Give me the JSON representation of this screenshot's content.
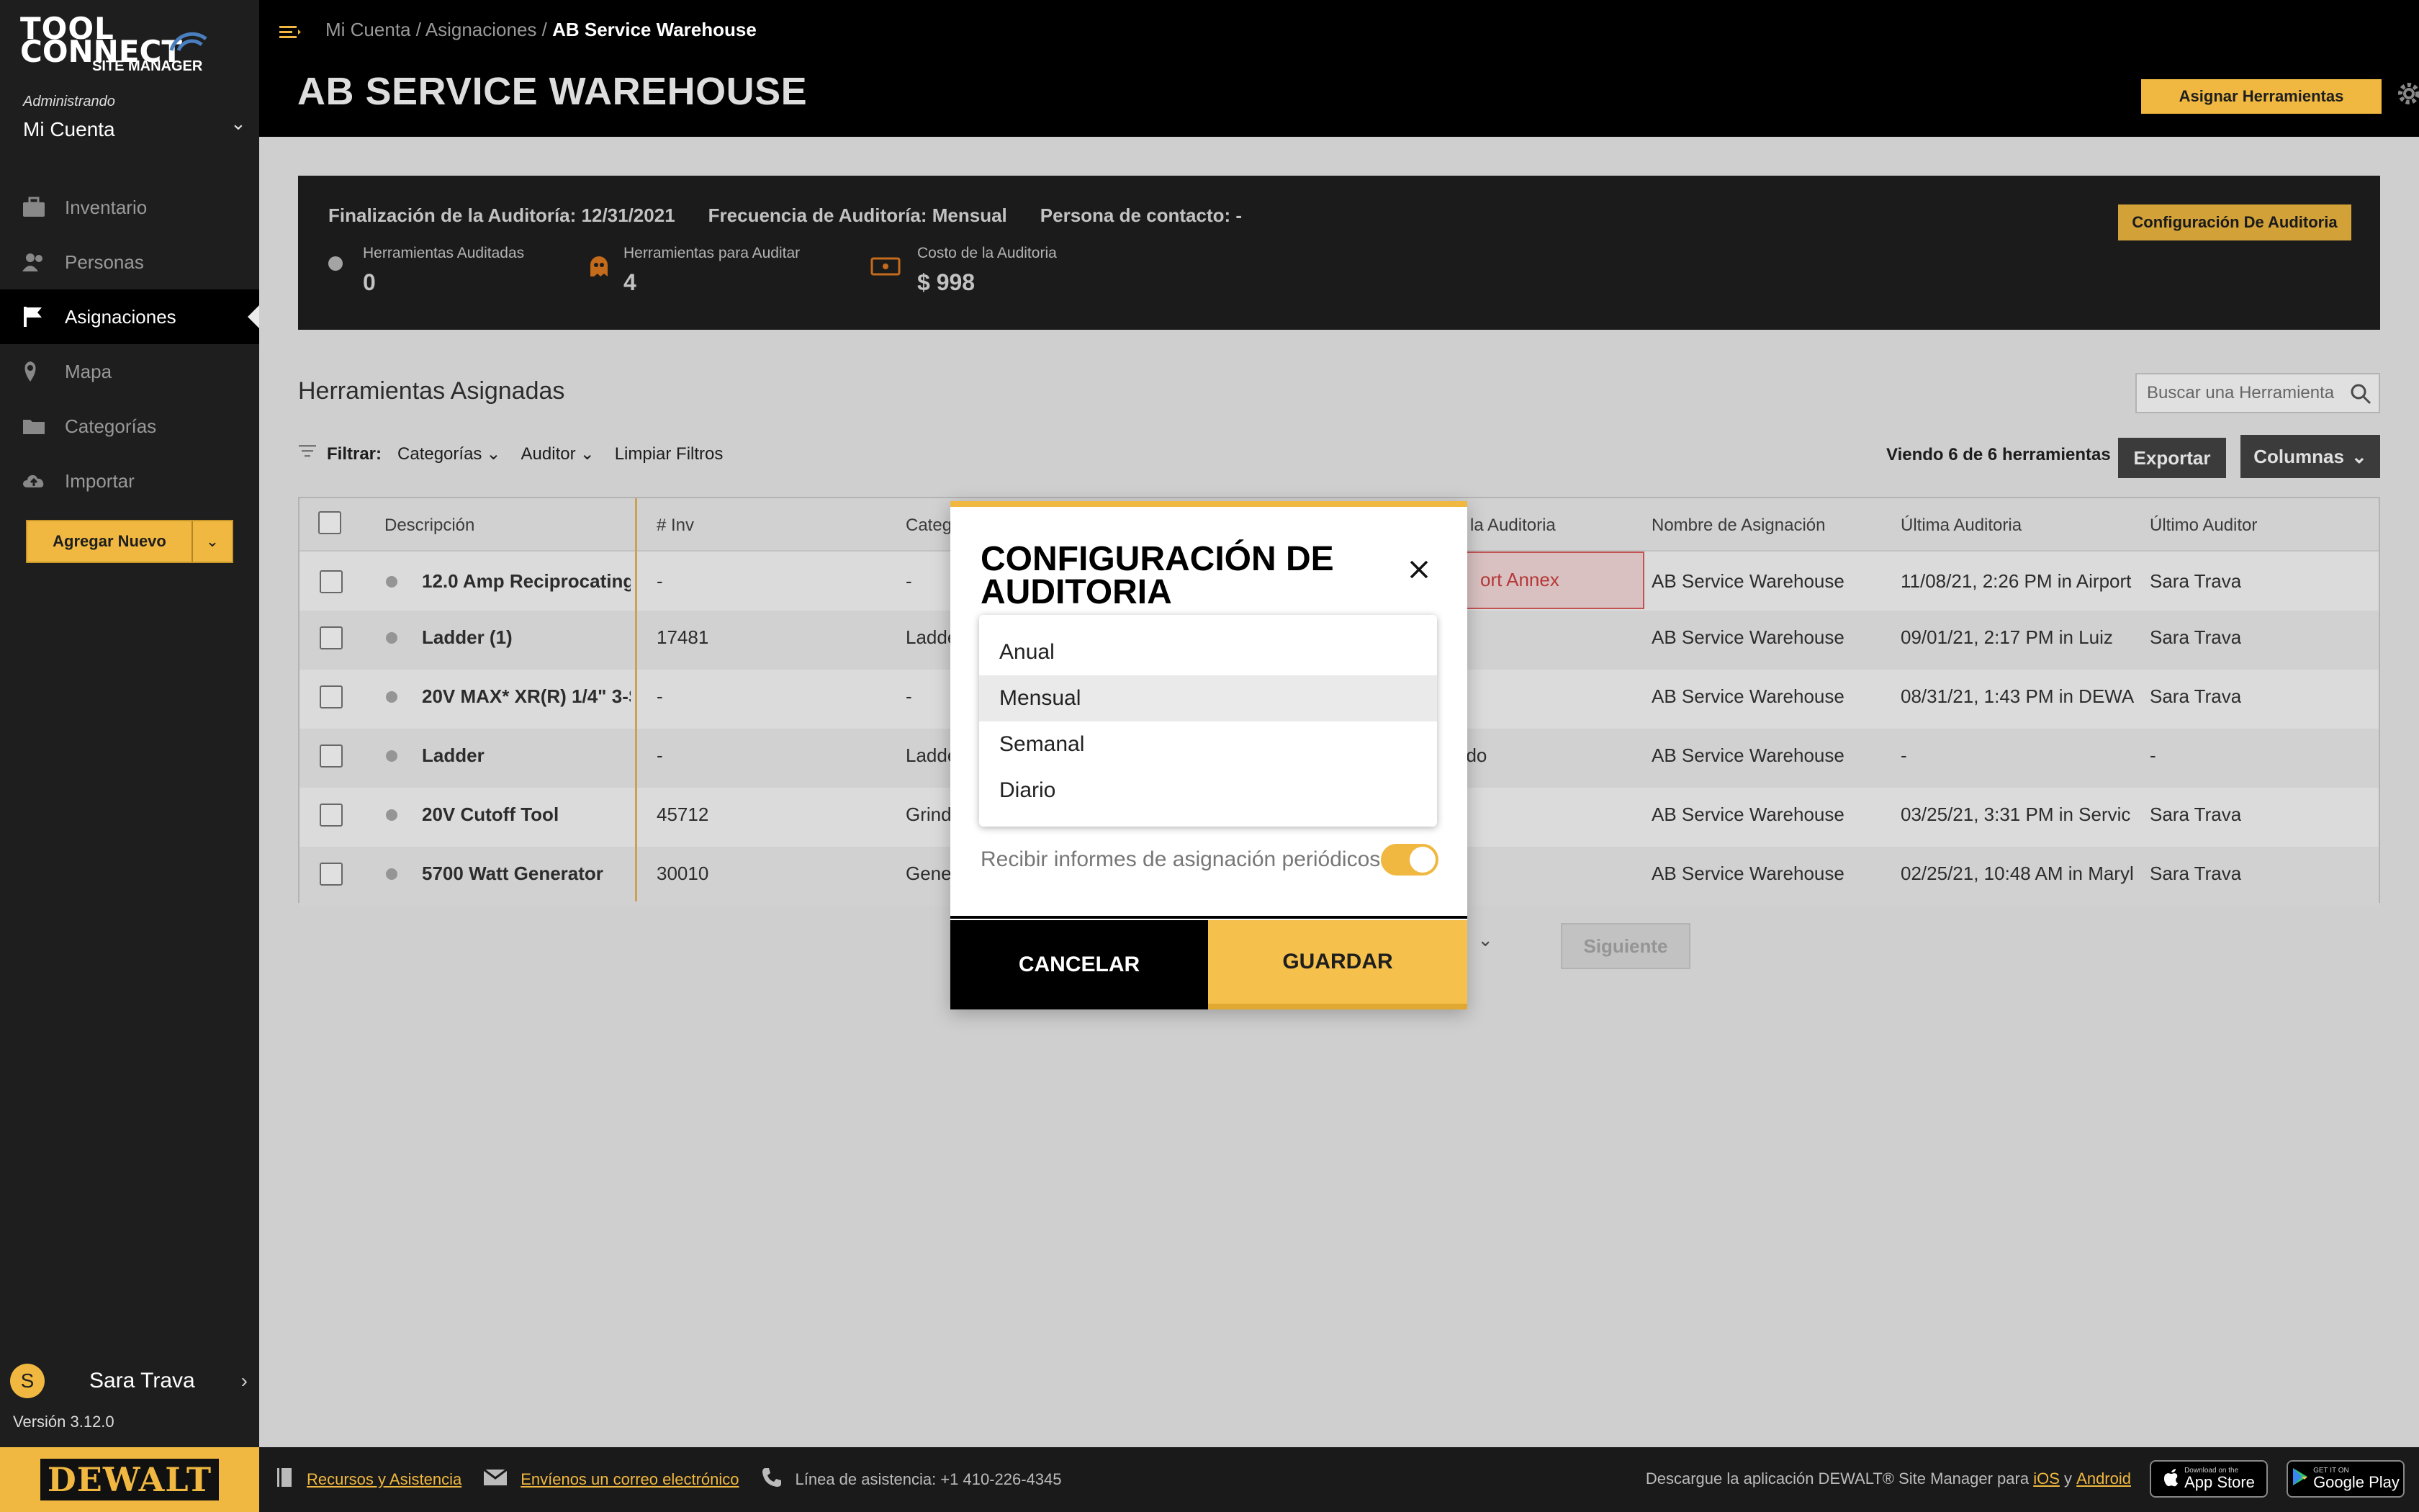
{
  "sidebar": {
    "logo_line1": "TOOL",
    "logo_line2": "CONNECT",
    "logo_sub": "SITE MANAGER",
    "account_label": "Administrando",
    "account_name": "Mi Cuenta",
    "items": [
      {
        "label": "Inventario",
        "icon": "toolbox-icon"
      },
      {
        "label": "Personas",
        "icon": "people-icon"
      },
      {
        "label": "Asignaciones",
        "icon": "flag-icon",
        "active": true
      },
      {
        "label": "Mapa",
        "icon": "map-pin-icon"
      },
      {
        "label": "Categorías",
        "icon": "folder-icon"
      },
      {
        "label": "Importar",
        "icon": "cloud-upload-icon"
      }
    ],
    "add_new": "Agregar Nuevo",
    "user_initial": "S",
    "user_name": "Sara Trava",
    "version": "Versión 3.12.0"
  },
  "header": {
    "breadcrumbs": [
      "Mi Cuenta",
      "Asignaciones",
      "AB Service Warehouse"
    ],
    "title": "AB SERVICE WAREHOUSE",
    "assign_button": "Asignar Herramientas"
  },
  "audit": {
    "end_date": "Finalización de la Auditoría: 12/31/2021",
    "frequency": "Frecuencia de Auditoría: Mensual",
    "contact": "Persona de contacto: -",
    "stats": [
      {
        "label": "Herramientas Auditadas",
        "value": "0"
      },
      {
        "label": "Herramientas para Auditar",
        "value": "4"
      },
      {
        "label": "Costo de la Auditoria",
        "value": "$ 998"
      }
    ],
    "config_button": "Configuración De Auditoria"
  },
  "section": {
    "title": "Herramientas Asignadas",
    "search_placeholder": "Buscar una Herramienta",
    "filter_label": "Filtrar:",
    "filters": [
      "Categorías",
      "Auditor"
    ],
    "clear_filters": "Limpiar Filtros",
    "count": "Viendo 6 de 6 herramientas",
    "export": "Exportar",
    "columns": "Columnas"
  },
  "table": {
    "headers": [
      "Descripción",
      "# Inv",
      "Categ",
      "e la Auditoria",
      "Nombre de Asignación",
      "Última Auditoria",
      "Último Auditor"
    ],
    "annex_text": "ort Annex",
    "rows": [
      {
        "desc": "12.0 Amp Reciprocating S",
        "inv": "-",
        "cat": "-",
        "audit": "",
        "assign": "AB Service Warehouse",
        "last": "11/08/21, 2:26 PM in Airport",
        "auditor": "Sara Trava"
      },
      {
        "desc": "Ladder (1)",
        "inv": "17481",
        "cat": "Ladde",
        "audit": "",
        "assign": "AB Service Warehouse",
        "last": "09/01/21, 2:17 PM in Luiz",
        "auditor": "Sara Trava"
      },
      {
        "desc": "20V MAX* XR(R) 1/4\" 3-S",
        "inv": "-",
        "cat": "-",
        "audit": "",
        "assign": "AB Service Warehouse",
        "last": "08/31/21, 1:43 PM in DEWA",
        "auditor": "Sara Trava"
      },
      {
        "desc": "Ladder",
        "inv": "-",
        "cat": "Ladde",
        "audit": "ado",
        "assign": "AB Service Warehouse",
        "last": "-",
        "auditor": "-"
      },
      {
        "desc": "20V Cutoff Tool",
        "inv": "45712",
        "cat": "Grind",
        "audit": "",
        "assign": "AB Service Warehouse",
        "last": "03/25/21, 3:31 PM in Servic",
        "auditor": "Sara Trava"
      },
      {
        "desc": "5700 Watt Generator",
        "inv": "30010",
        "cat": "Gene",
        "audit": "",
        "assign": "AB Service Warehouse",
        "last": "02/25/21, 10:48 AM in Maryl",
        "auditor": "Sara Trava"
      }
    ]
  },
  "pagination": {
    "select_tail": "s",
    "next": "Siguiente"
  },
  "modal": {
    "title": "CONFIGURACIÓN DE AUDITORIA",
    "options": [
      "Anual",
      "Mensual",
      "Semanal",
      "Diario"
    ],
    "selected": "Mensual",
    "toggle_label": "Recibir informes de asignación periódicos",
    "toggle_on": true,
    "cancel": "CANCELAR",
    "save": "GUARDAR"
  },
  "footer": {
    "brand": "DEWALT",
    "resources": "Recursos y Asistencia",
    "email": "Envíenos un correo electrónico",
    "hotline": "Línea de asistencia: +1 410-226-4345",
    "download_text": "Descargue la aplicación DEWALT® Site Manager para",
    "ios": "iOS",
    "and": "y",
    "android": "Android",
    "appstore_small": "Download on the",
    "appstore": "App Store",
    "gplay_small": "GET IT ON",
    "gplay": "Google Play"
  },
  "colors": {
    "accent": "#f0b840",
    "sidebar": "#1e1e1e",
    "header": "#000000",
    "alert": "#d04040"
  }
}
